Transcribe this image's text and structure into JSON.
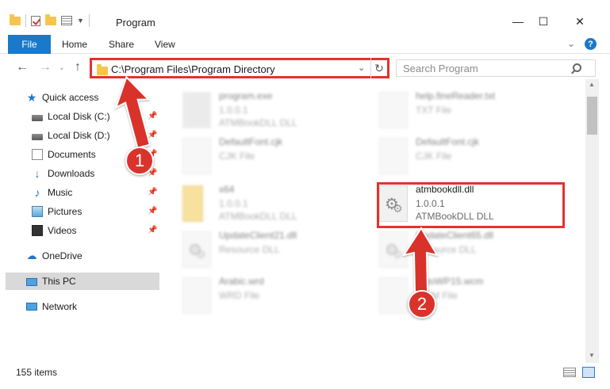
{
  "window": {
    "title": "Program",
    "minimize": "—",
    "maximize": "☐",
    "close": "✕"
  },
  "ribbon": {
    "tabs": [
      "File",
      "Home",
      "Share",
      "View"
    ],
    "expand": "⌄",
    "help": "?"
  },
  "nav": {
    "back": "←",
    "forward": "→",
    "recent": "⌄",
    "up": "↑",
    "address": "C:\\Program Files\\Program Directory",
    "address_dropdown": "⌄",
    "refresh": "↻",
    "search_placeholder": "Search Program"
  },
  "sidebar": {
    "items": [
      {
        "label": "Quick access",
        "icon": "star-icon"
      },
      {
        "label": "Local Disk (C:)",
        "icon": "disk-icon",
        "pinned": true
      },
      {
        "label": "Local Disk (D:)",
        "icon": "disk-icon",
        "pinned": true
      },
      {
        "label": "Documents",
        "icon": "documents-icon",
        "pinned": true
      },
      {
        "label": "Downloads",
        "icon": "downloads-icon",
        "pinned": true
      },
      {
        "label": "Music",
        "icon": "music-icon",
        "pinned": true
      },
      {
        "label": "Pictures",
        "icon": "pictures-icon",
        "pinned": true
      },
      {
        "label": "Videos",
        "icon": "videos-icon",
        "pinned": true
      },
      {
        "label": "OneDrive",
        "icon": "onedrive-icon"
      },
      {
        "label": "This PC",
        "icon": "pc-icon",
        "selected": true
      },
      {
        "label": "Network",
        "icon": "network-icon"
      }
    ],
    "pin_glyph": "📌"
  },
  "files": [
    {
      "name": "program.exe",
      "line1": "1.0.0.1",
      "line2": "ATMBookDLL DLL",
      "icon": "exe-icon"
    },
    {
      "name": "help.fineReader.txt",
      "line1": "TXT File",
      "line2": "",
      "icon": "text-file-icon"
    },
    {
      "name": "DefaultFont.cjk",
      "line1": "CJK File",
      "line2": "",
      "icon": "file-icon"
    },
    {
      "name": "DefaultFont.cjk",
      "line1": "CJK File",
      "line2": "",
      "icon": "file-icon"
    },
    {
      "name": "x64",
      "line1": "1.0.0.1",
      "line2": "ATMBookDLL DLL",
      "icon": "folder-icon"
    },
    {
      "name": "atmbookdll.dll",
      "line1": "1.0.0.1",
      "line2": "ATMBookDLL DLL",
      "icon": "dll-gear-icon"
    },
    {
      "name": "UpdateClient21.dll",
      "line1": "Resource DLL",
      "line2": "",
      "icon": "dll-gear-icon"
    },
    {
      "name": "UpdateClient65.dll",
      "line1": "Resource DLL",
      "line2": "",
      "icon": "dll-gear-icon"
    },
    {
      "name": "Arabic.wrd",
      "line1": "WRD File",
      "line2": "",
      "icon": "file-icon"
    },
    {
      "name": "AutoWP15.wcm",
      "line1": "WCM File",
      "line2": "",
      "icon": "file-icon"
    }
  ],
  "status": {
    "item_count": "155 items"
  },
  "annotations": {
    "step1": "1",
    "step2": "2",
    "accent_color": "#d9332b"
  },
  "colors": {
    "file_tab": "#1979ca",
    "highlight": "#e2332c"
  }
}
